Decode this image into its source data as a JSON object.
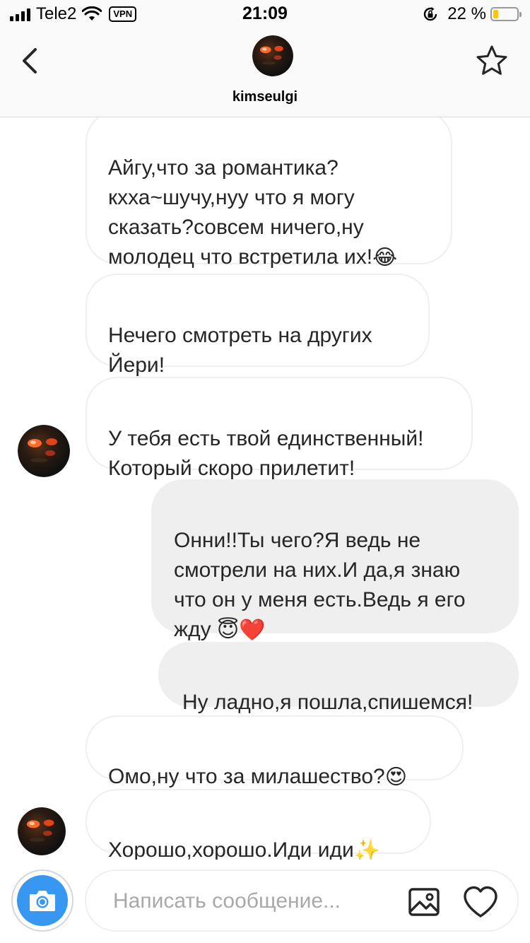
{
  "status": {
    "carrier": "Tele2",
    "vpn": "VPN",
    "time": "21:09",
    "battery_pct": "22 %",
    "battery_level": 0.22,
    "icons": [
      "signal-icon",
      "wifi-icon",
      "rotation-lock-icon",
      "battery-icon"
    ]
  },
  "header": {
    "username": "kimseulgi",
    "icons": [
      "back-chevron-icon",
      "avatar",
      "star-icon"
    ]
  },
  "messages": [
    {
      "dir": "in",
      "text": "Айгу,что за романтика?\nкхха~шучу,нуу что я могу\nсказать?совсем ничего,ну\nмолодец что встретила их!",
      "emoji": "😂"
    },
    {
      "dir": "in",
      "text": "Нечего смотреть на других\nЙери!"
    },
    {
      "dir": "in",
      "text": "У тебя есть твой единственный!\nКоторый скоро прилетит!"
    },
    {
      "dir": "out",
      "text": "Онни!!Ты чего?Я ведь не\nсмотрели на них.И да,я знаю\nчто он у меня есть.Ведь я его\nжду ",
      "emoji": "😇❤️"
    },
    {
      "dir": "out",
      "text": "Ну ладно,я пошла,спишемся!"
    },
    {
      "dir": "in",
      "text": "Омо,ну что за милашество?",
      "emoji": "😍"
    },
    {
      "dir": "in",
      "text": "Хорошо,хорошо.Иди иди",
      "emoji": "✨"
    }
  ],
  "composer": {
    "placeholder": "Написать сообщение...",
    "icons": [
      "camera-icon",
      "gallery-icon",
      "heart-icon"
    ]
  },
  "colors": {
    "accent": "#3897f0",
    "outgoing_bubble": "#efefef",
    "incoming_border": "#efefef",
    "header_bg": "#f9f9f9",
    "battery_fill": "#f5c518"
  }
}
